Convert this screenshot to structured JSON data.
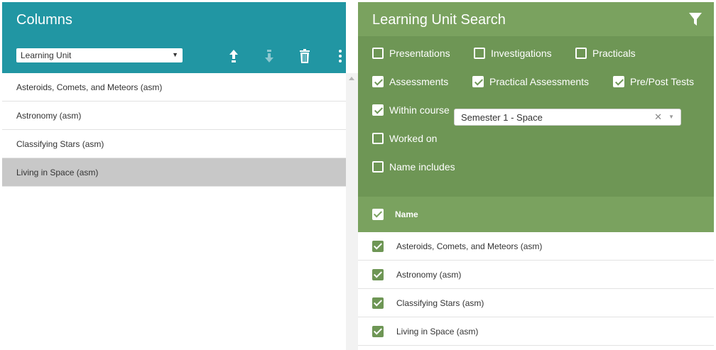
{
  "columns_panel": {
    "title": "Columns",
    "select_value": "Learning Unit",
    "toolbar_icons": [
      "move-up-icon",
      "move-down-icon",
      "trash-icon",
      "more-vertical-icon"
    ],
    "items": [
      {
        "label": "Asteroids, Comets, and Meteors (asm)",
        "selected": false
      },
      {
        "label": "Astronomy (asm)",
        "selected": false
      },
      {
        "label": "Classifying Stars (asm)",
        "selected": false
      },
      {
        "label": "Living in Space (asm)",
        "selected": true
      }
    ]
  },
  "search_panel": {
    "title": "Learning Unit Search",
    "filters": {
      "presentations": {
        "label": "Presentations",
        "checked": false
      },
      "investigations": {
        "label": "Investigations",
        "checked": false
      },
      "practicals": {
        "label": "Practicals",
        "checked": false
      },
      "assessments": {
        "label": "Assessments",
        "checked": true
      },
      "practical_assessments": {
        "label": "Practical Assessments",
        "checked": true
      },
      "pre_post_tests": {
        "label": "Pre/Post Tests",
        "checked": true
      },
      "within_course": {
        "label": "Within course",
        "checked": true
      },
      "worked_on": {
        "label": "Worked on",
        "checked": false
      },
      "name_includes": {
        "label": "Name includes",
        "checked": false
      }
    },
    "course_select_value": "Semester 1 - Space",
    "clear_glyph": "✕",
    "table": {
      "header": "Name",
      "rows": [
        {
          "label": "Asteroids, Comets, and Meteors (asm)",
          "checked": true
        },
        {
          "label": "Astronomy (asm)",
          "checked": true
        },
        {
          "label": "Classifying Stars (asm)",
          "checked": true
        },
        {
          "label": "Living in Space (asm)",
          "checked": true
        }
      ]
    }
  },
  "colors": {
    "teal_header": "#2196a3",
    "green_header": "#7aa25f",
    "green_filters": "#6e9655",
    "selected_row": "#c8c8c8"
  }
}
